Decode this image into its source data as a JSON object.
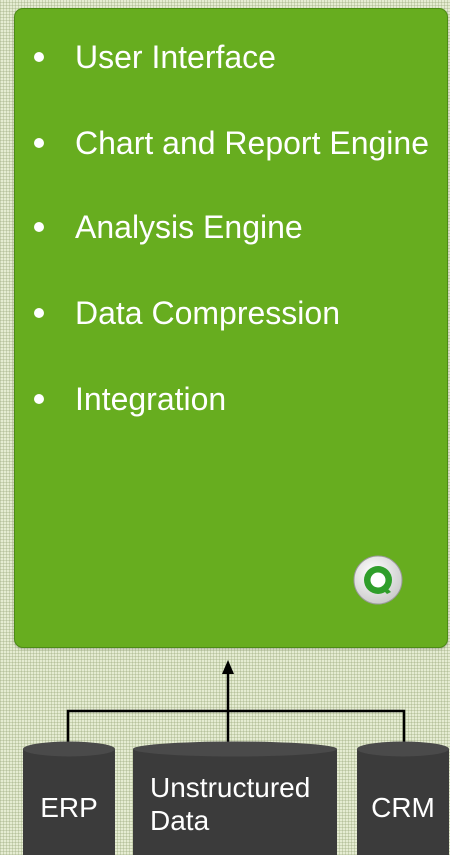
{
  "engine": {
    "bullets": [
      {
        "text": "User Interface"
      },
      {
        "text": "Chart and Report Engine"
      },
      {
        "text": "Analysis Engine"
      },
      {
        "text": "Data Compression"
      },
      {
        "text": "Integration"
      }
    ],
    "logo_icon": "qlikview-logo-icon"
  },
  "sources": [
    {
      "label": "ERP"
    },
    {
      "label": "Unstructured Data"
    },
    {
      "label": "CRM"
    }
  ],
  "colors": {
    "panel": "#67ad1f",
    "cylinder": "#3c3c3c",
    "connector": "#000000"
  }
}
